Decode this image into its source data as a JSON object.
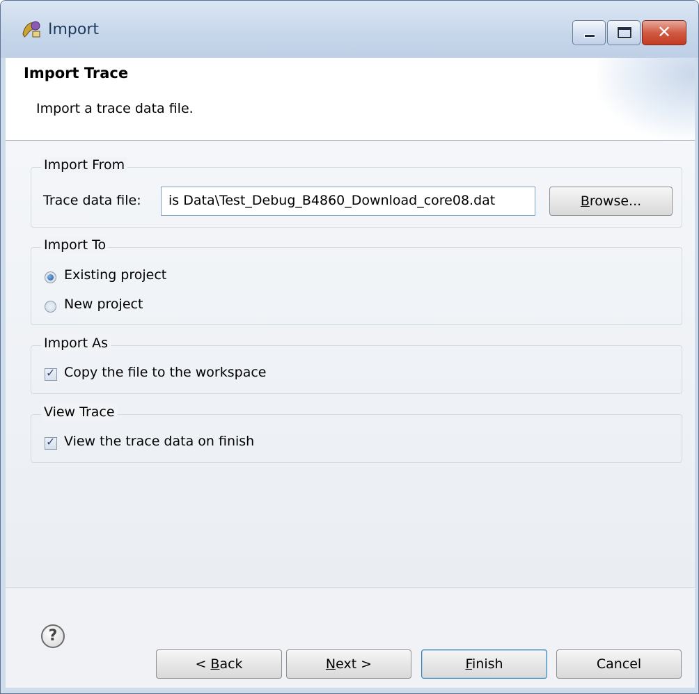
{
  "window": {
    "title": "Import",
    "icon": "eclipse-import-wizard-icon",
    "controls": {
      "minimize": "minimize-icon",
      "maximize": "maximize-icon",
      "close": "close-icon",
      "close_glyph": "✕"
    }
  },
  "header": {
    "title": "Import Trace",
    "description": "Import a trace data file."
  },
  "import_from": {
    "group_label": "Import From",
    "field_label": "Trace data file:",
    "file_value": "is Data\\Test_Debug_B4860_Download_core08.dat",
    "browse_first": "B",
    "browse_rest": "rowse..."
  },
  "import_to": {
    "group_label": "Import To",
    "options": [
      {
        "label": "Existing project",
        "selected": true
      },
      {
        "label": "New project",
        "selected": false
      }
    ]
  },
  "import_as": {
    "group_label": "Import As",
    "checkbox_label": "Copy the file to the workspace",
    "checked": true
  },
  "view_trace": {
    "group_label": "View Trace",
    "checkbox_label": "View the trace data on finish",
    "checked": true
  },
  "footer": {
    "help_glyph": "?",
    "back_prefix": "< ",
    "back_first": "B",
    "back_rest": "ack",
    "next_first": "N",
    "next_rest": "ext >",
    "finish_first": "F",
    "finish_rest": "inish",
    "cancel": "Cancel"
  },
  "colors": {
    "frame": "#cfdcec",
    "default_button_border": "#3c7fb1",
    "input_border": "#7a9fc8"
  }
}
